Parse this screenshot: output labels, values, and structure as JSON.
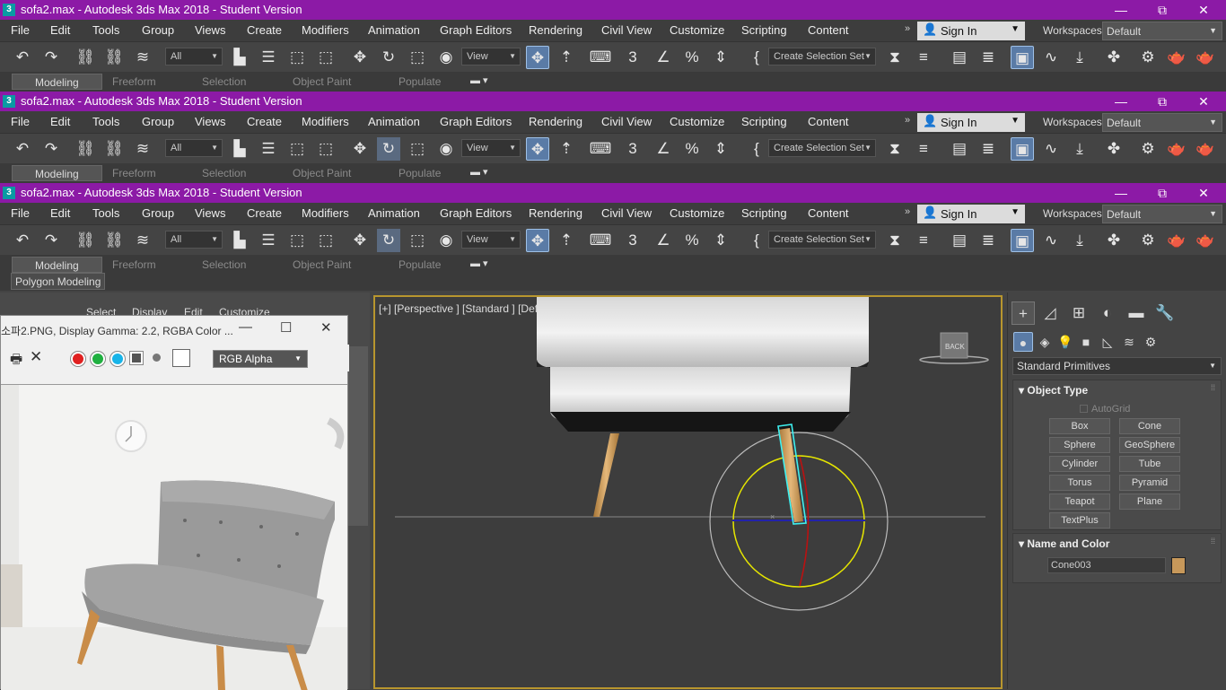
{
  "window": {
    "title": "sofa2.max - Autodesk 3ds Max 2018 - Student Version",
    "app_icon": "3",
    "minimize_glyph": "—",
    "restore_glyph": "⧉",
    "close_glyph": "✕"
  },
  "menu": {
    "items": [
      "File",
      "Edit",
      "Tools",
      "Group",
      "Views",
      "Create",
      "Modifiers",
      "Animation",
      "Graph Editors",
      "Rendering",
      "Civil View",
      "Customize",
      "Scripting",
      "Content"
    ],
    "overflow": "»",
    "sign_in": "Sign In",
    "workspaces_label": "Workspaces:",
    "workspace_value": "Default"
  },
  "toolbar": {
    "selection_filter": "All",
    "ref_coord": "View",
    "named_selection": "Create Selection Set",
    "icons": [
      "undo-icon",
      "redo-icon",
      "link-icon",
      "unlink-icon",
      "bind-spacewarp-icon",
      "select-object-icon",
      "select-by-name-icon",
      "rect-region-icon",
      "window-crossing-icon",
      "move-icon",
      "rotate-icon",
      "scale-icon",
      "place-icon",
      "pivot-icon",
      "manipulate-icon",
      "keyboard-shortcut-icon",
      "snap-3d-icon",
      "angle-snap-icon",
      "percent-snap-icon",
      "spinner-snap-icon",
      "edit-named-sel-icon",
      "mirror-icon",
      "align-icon",
      "layer-explorer-icon",
      "scene-explorer-icon",
      "ribbon-toggle-icon",
      "curve-editor-icon",
      "schematic-icon",
      "material-editor-icon",
      "render-setup-icon",
      "render-frame-icon",
      "render-icon"
    ]
  },
  "ribbon": {
    "tabs": [
      "Modeling",
      "Freeform",
      "Selection",
      "Object Paint",
      "Populate"
    ],
    "active_tab": "Modeling",
    "polygon_modeling": "Polygon Modeling"
  },
  "scene_explorer": {
    "menu": [
      "Select",
      "Display",
      "Edit",
      "Customize"
    ]
  },
  "image_viewer": {
    "title": "소파2.PNG, Display Gamma: 2.2, RGBA Color ...",
    "channel": "RGB Alpha",
    "swatches": [
      "#e02020",
      "#20b040",
      "#18b4e8"
    ]
  },
  "viewport": {
    "label": "[+] [Perspective ] [Standard ] [Default Shading ]",
    "viewcube_face": "BACK"
  },
  "command_panel": {
    "category": "Standard Primitives",
    "object_type_title": "Object Type",
    "autogrid": "AutoGrid",
    "primitives": [
      "Box",
      "Cone",
      "Sphere",
      "GeoSphere",
      "Cylinder",
      "Tube",
      "Torus",
      "Pyramid",
      "Teapot",
      "Plane",
      "TextPlus"
    ],
    "name_color_title": "Name and Color",
    "object_name": "Cone003",
    "object_color": "#c7985a"
  }
}
